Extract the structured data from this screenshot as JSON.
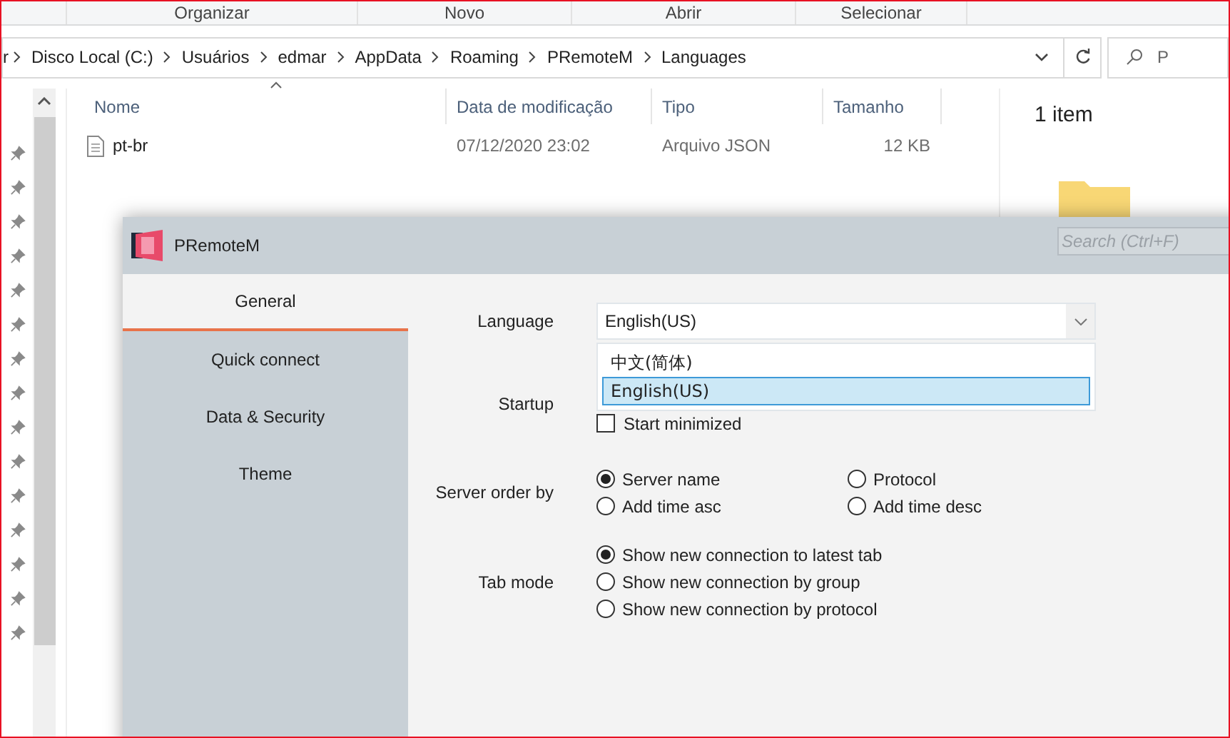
{
  "ribbon": {
    "groups": [
      "Organizar",
      "Novo",
      "Abrir",
      "Selecionar"
    ]
  },
  "address_bar": {
    "crumbs": [
      "r",
      "Disco Local (C:)",
      "Usuários",
      "edmar",
      "AppData",
      "Roaming",
      "PRemoteM",
      "Languages"
    ],
    "search_placeholder": "P"
  },
  "file_list": {
    "columns": [
      "Nome",
      "Data de modificação",
      "Tipo",
      "Tamanho"
    ],
    "rows": [
      {
        "name": "pt-br",
        "modified": "07/12/2020 23:02",
        "type": "Arquivo JSON",
        "size": "12 KB"
      }
    ]
  },
  "details_pane": {
    "count": "1 item"
  },
  "app_window": {
    "title": "PRemoteM",
    "search_placeholder": "Search (Ctrl+F)",
    "sidebar": [
      {
        "label": "General",
        "selected": true
      },
      {
        "label": "Quick connect",
        "selected": false
      },
      {
        "label": "Data & Security",
        "selected": false
      },
      {
        "label": "Theme",
        "selected": false
      }
    ],
    "language": {
      "label": "Language",
      "value": "English(US)",
      "expanded": true,
      "options": [
        {
          "label": "中文(简体)",
          "selected": false
        },
        {
          "label": "English(US)",
          "selected": true
        }
      ]
    },
    "startup": {
      "label": "Startup",
      "options": [
        {
          "label": "Start minimized",
          "checked": false
        }
      ]
    },
    "server_order": {
      "label": "Server order by",
      "options": [
        {
          "label": "Server name",
          "selected": true
        },
        {
          "label": "Protocol",
          "selected": false
        },
        {
          "label": "Add time asc",
          "selected": false
        },
        {
          "label": "Add time desc",
          "selected": false
        }
      ]
    },
    "tab_mode": {
      "label": "Tab mode",
      "options": [
        {
          "label": "Show new connection to latest tab",
          "selected": true
        },
        {
          "label": "Show new connection by group",
          "selected": false
        },
        {
          "label": "Show new connection by protocol",
          "selected": false
        }
      ]
    }
  }
}
